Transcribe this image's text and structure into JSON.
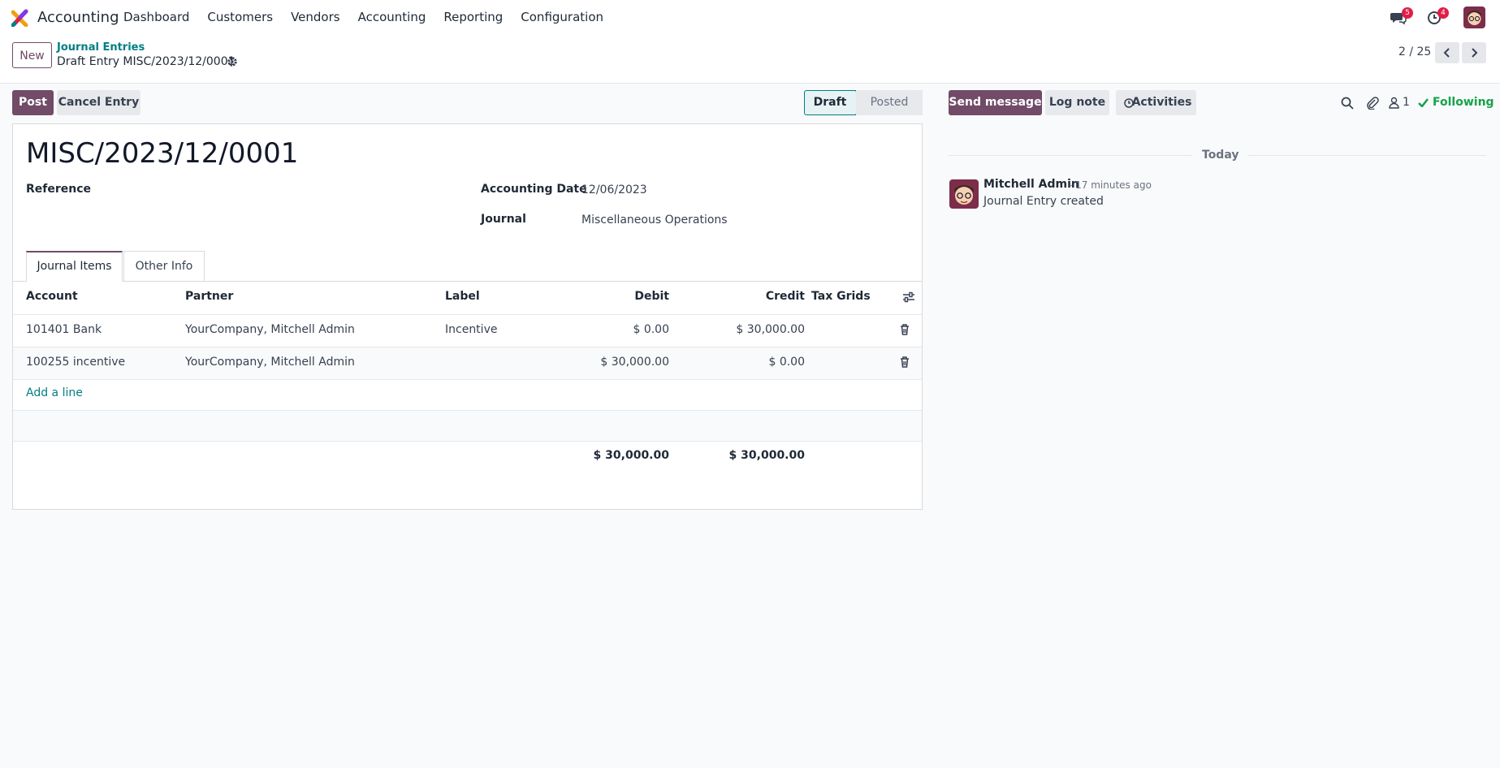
{
  "app": {
    "name": "Accounting"
  },
  "menu": [
    "Dashboard",
    "Customers",
    "Vendors",
    "Accounting",
    "Reporting",
    "Configuration"
  ],
  "systray": {
    "messages_count": "5",
    "activities_count": "4"
  },
  "breadcrumb": {
    "parent": "Journal Entries",
    "current": "Draft Entry MISC/2023/12/0001"
  },
  "buttons": {
    "new": "New",
    "post": "Post",
    "cancel_entry": "Cancel Entry"
  },
  "pager": {
    "value": "2 / 25"
  },
  "status": {
    "draft": "Draft",
    "posted": "Posted"
  },
  "chatter": {
    "send_message": "Send message",
    "log_note": "Log note",
    "activities": "Activities",
    "followers_count": "1",
    "following": "Following",
    "date_separator": "Today",
    "message": {
      "author": "Mitchell Admin",
      "time": "- 17 minutes ago",
      "body": "Journal Entry created"
    }
  },
  "form": {
    "title": "MISC/2023/12/0001",
    "reference_label": "Reference",
    "accounting_date_label": "Accounting Date",
    "accounting_date": "12/06/2023",
    "journal_label": "Journal",
    "journal": "Miscellaneous Operations"
  },
  "tabs": [
    "Journal Items",
    "Other Info"
  ],
  "table": {
    "headers": {
      "account": "Account",
      "partner": "Partner",
      "label": "Label",
      "debit": "Debit",
      "credit": "Credit",
      "tax_grids": "Tax Grids"
    },
    "rows": [
      {
        "account": "101401 Bank",
        "partner": "YourCompany, Mitchell Admin",
        "label": "Incentive",
        "debit": "$ 0.00",
        "credit": "$ 30,000.00"
      },
      {
        "account": "100255 incentive",
        "partner": "YourCompany, Mitchell Admin",
        "label": "",
        "debit": "$ 30,000.00",
        "credit": "$ 0.00"
      }
    ],
    "add_line": "Add a line",
    "totals": {
      "debit": "$ 30,000.00",
      "credit": "$ 30,000.00"
    }
  },
  "colors": {
    "brand": "#714b67",
    "accent": "#017e84",
    "following": "#16a34a",
    "badge": "#e11d48"
  }
}
